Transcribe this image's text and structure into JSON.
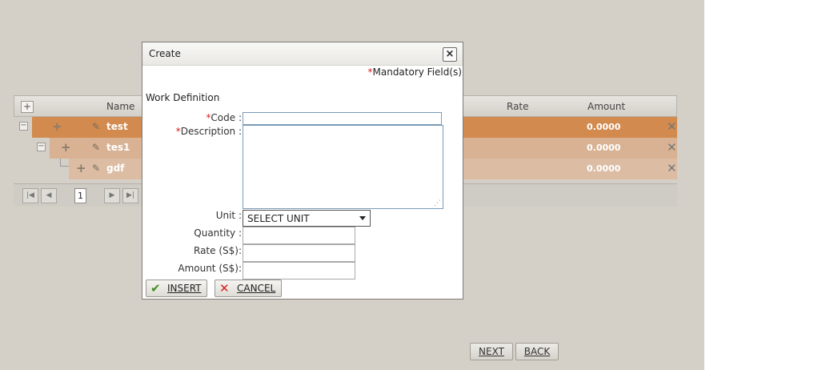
{
  "grid": {
    "columns": {
      "name": "Name",
      "rate": "Rate",
      "amount": "Amount"
    },
    "expand_all": "+",
    "rows": [
      {
        "name": "test",
        "amount": "0.0000",
        "color": "#d28a4e"
      },
      {
        "name": "tes1",
        "amount": "0.0000",
        "color": "#d8b293"
      },
      {
        "name": "gdf",
        "amount": "0.0000",
        "color": "#dcbca2"
      }
    ],
    "pager": {
      "page": "1"
    }
  },
  "nav": {
    "next": "NEXT",
    "back": "BACK"
  },
  "dialog": {
    "title": "Create",
    "close": "×",
    "mandatory_star": "*",
    "mandatory_text": "Mandatory Field(s)",
    "section": "Work Definition",
    "fields": {
      "code": {
        "star": "*",
        "label": "Code :",
        "value": ""
      },
      "description": {
        "star": "*",
        "label": "Description :",
        "value": ""
      },
      "unit": {
        "label": "Unit :",
        "selected": "SELECT UNIT"
      },
      "quantity": {
        "label": "Quantity :",
        "value": ""
      },
      "rate": {
        "label": "Rate (S$):",
        "value": ""
      },
      "amount": {
        "label": "Amount (S$):",
        "value": ""
      }
    },
    "insert_label": "INSERT",
    "cancel_label": "CANCEL"
  },
  "colors": {
    "background": "#d4d0c8",
    "row_selected": "#d28a4e",
    "check": "#3f8f1f",
    "cancel_x": "#d42020"
  },
  "icons": [
    "plus-icon",
    "pencil-icon",
    "delete-icon",
    "close-icon",
    "check-icon",
    "cancel-icon",
    "first-page-icon",
    "prev-page-icon",
    "next-page-icon",
    "last-page-icon",
    "resize-grip-icon",
    "dropdown-arrow-icon"
  ]
}
